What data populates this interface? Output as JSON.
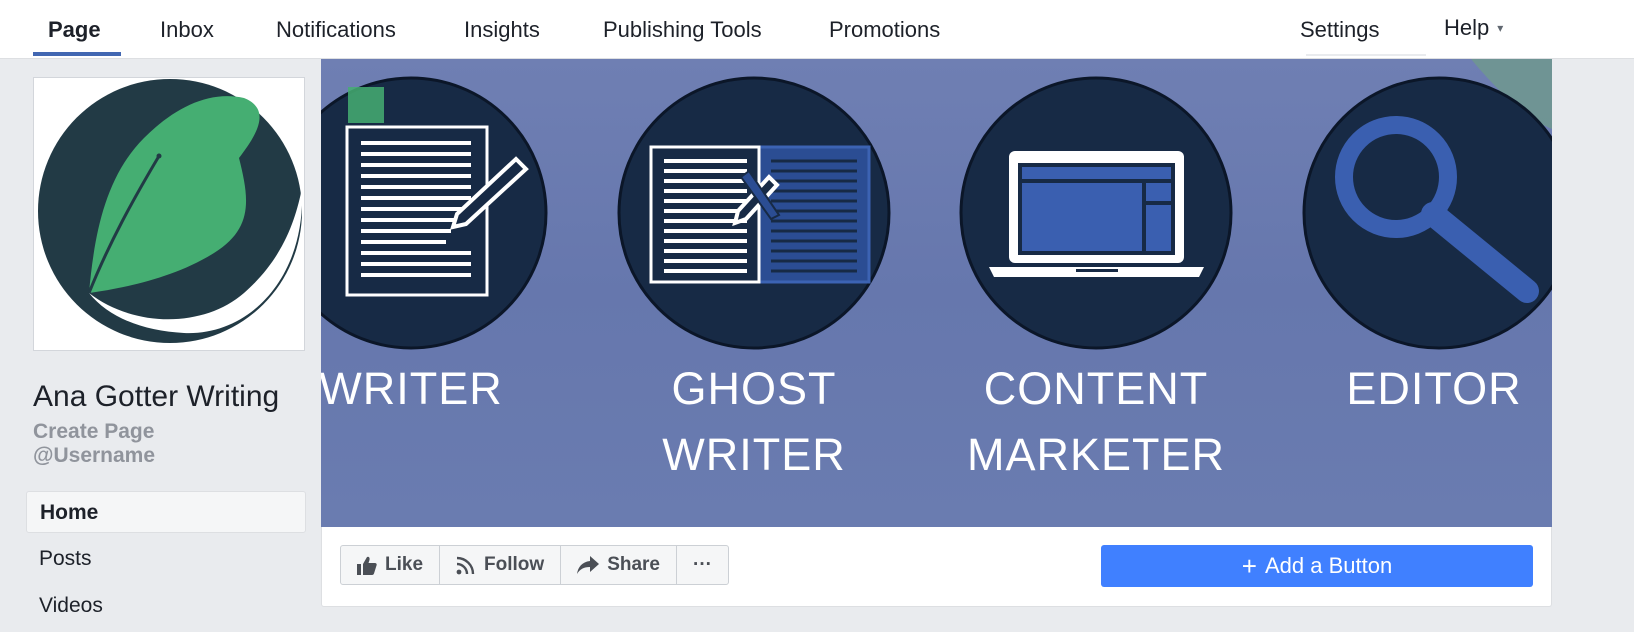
{
  "topnav": {
    "tabs": [
      {
        "label": "Page",
        "active": true
      },
      {
        "label": "Inbox"
      },
      {
        "label": "Notifications"
      },
      {
        "label": "Insights"
      },
      {
        "label": "Publishing Tools"
      },
      {
        "label": "Promotions"
      }
    ],
    "settings_label": "Settings",
    "help_label": "Help",
    "help_caret": "▾"
  },
  "profile": {
    "page_name": "Ana Gotter Writing",
    "create_username_line1": "Create Page",
    "create_username_line2": "@Username"
  },
  "sidenav": {
    "items": [
      {
        "label": "Home",
        "active": true
      },
      {
        "label": "Posts"
      },
      {
        "label": "Videos"
      }
    ]
  },
  "cover": {
    "labels": [
      {
        "line1": "WRITER",
        "line2": ""
      },
      {
        "line1": "GHOST",
        "line2": "WRITER"
      },
      {
        "line1": "CONTENT",
        "line2": "MARKETER"
      },
      {
        "line1": "EDITOR",
        "line2": ""
      }
    ],
    "icons": [
      "document-pen-icon",
      "ghostwriter-documents-icon",
      "laptop-icon",
      "magnifier-icon"
    ]
  },
  "actions": {
    "like_label": "Like",
    "follow_label": "Follow",
    "share_label": "Share",
    "more_label": "···",
    "add_button_label": "Add a Button",
    "add_button_plus": "+"
  },
  "colors": {
    "brand_blue": "#4267b2",
    "cta_blue": "#4080ff",
    "cover_bg": "#6a7bb0",
    "icon_circle": "#172a45",
    "leaf_green": "#45ae72"
  }
}
